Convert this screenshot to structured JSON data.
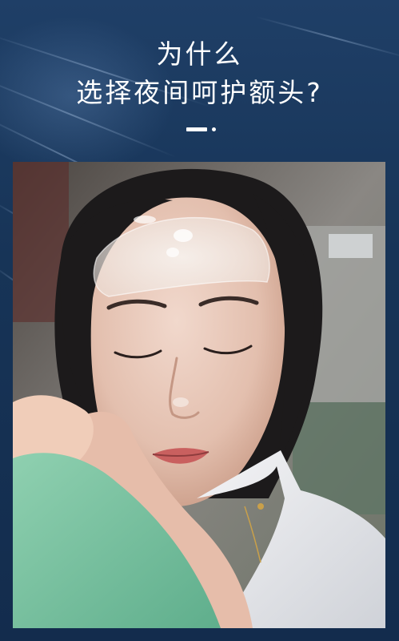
{
  "header": {
    "title_line1": "为什么",
    "title_line2": "选择夜间呵护额头?"
  },
  "photo": {
    "subject": "sleeping-woman-with-forehead-patch"
  },
  "colors": {
    "background_top": "#1f3f67",
    "background_bottom": "#132c4d",
    "title_text": "#ffffff"
  }
}
